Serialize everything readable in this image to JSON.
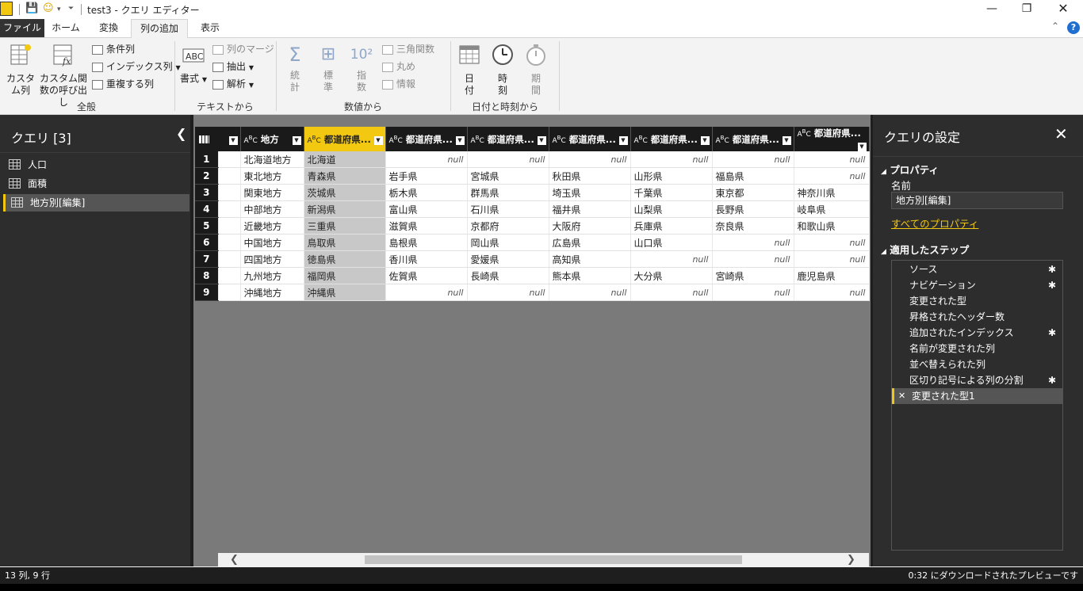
{
  "window": {
    "title": "test3 - クエリ エディター"
  },
  "tabs": [
    "ファイル",
    "ホーム",
    "変換",
    "列の追加",
    "表示"
  ],
  "ribbon": {
    "general": {
      "custom_column": "カスタム列",
      "custom_function": "カスタム関数の呼び出し",
      "conditional_column": "条件列",
      "index_column": "インデックス列",
      "duplicate_column": "重複する列",
      "label": "全般"
    },
    "text": {
      "format": "書式",
      "merge_columns": "列のマージ",
      "extract": "抽出",
      "parse": "解析",
      "label": "テキストから"
    },
    "number": {
      "statistics": "統計",
      "standard": "標準",
      "scientific": "指数",
      "trigonometry": "三角関数",
      "rounding": "丸め",
      "information": "情報",
      "label": "数値から"
    },
    "datetime": {
      "date": "日付",
      "time": "時刻",
      "duration": "期間",
      "label": "日付と時刻から"
    }
  },
  "queries": {
    "header": "クエリ [3]",
    "items": [
      "人口",
      "面積",
      "地方別[編集]"
    ]
  },
  "grid": {
    "columns": [
      "地方",
      "都道府県...",
      "都道府県...",
      "都道府県...",
      "都道府県...",
      "都道府県...",
      "都道府県...",
      "都道府県..."
    ],
    "rows": [
      [
        "1",
        "北海道地方",
        "北海道",
        "null",
        "null",
        "null",
        "null",
        "null",
        "null"
      ],
      [
        "2",
        "東北地方",
        "青森県",
        "岩手県",
        "宮城県",
        "秋田県",
        "山形県",
        "福島県",
        "null"
      ],
      [
        "3",
        "関東地方",
        "茨城県",
        "栃木県",
        "群馬県",
        "埼玉県",
        "千葉県",
        "東京都",
        "神奈川県"
      ],
      [
        "4",
        "中部地方",
        "新潟県",
        "富山県",
        "石川県",
        "福井県",
        "山梨県",
        "長野県",
        "岐阜県"
      ],
      [
        "5",
        "近畿地方",
        "三重県",
        "滋賀県",
        "京都府",
        "大阪府",
        "兵庫県",
        "奈良県",
        "和歌山県"
      ],
      [
        "6",
        "中国地方",
        "鳥取県",
        "島根県",
        "岡山県",
        "広島県",
        "山口県",
        "null",
        "null"
      ],
      [
        "7",
        "四国地方",
        "徳島県",
        "香川県",
        "愛媛県",
        "高知県",
        "null",
        "null",
        "null"
      ],
      [
        "8",
        "九州地方",
        "福岡県",
        "佐賀県",
        "長崎県",
        "熊本県",
        "大分県",
        "宮崎県",
        "鹿児島県"
      ],
      [
        "9",
        "沖縄地方",
        "沖縄県",
        "null",
        "null",
        "null",
        "null",
        "null",
        "null"
      ]
    ]
  },
  "settings": {
    "header": "クエリの設定",
    "properties_label": "プロパティ",
    "name_label": "名前",
    "name_value": "地方別[編集]",
    "all_properties": "すべてのプロパティ",
    "applied_steps_label": "適用したステップ",
    "steps": [
      {
        "label": "ソース",
        "gear": true
      },
      {
        "label": "ナビゲーション",
        "gear": true
      },
      {
        "label": "変更された型",
        "gear": false
      },
      {
        "label": "昇格されたヘッダー数",
        "gear": false
      },
      {
        "label": "追加されたインデックス",
        "gear": true
      },
      {
        "label": "名前が変更された列",
        "gear": false
      },
      {
        "label": "並べ替えられた列",
        "gear": false
      },
      {
        "label": "区切り記号による列の分割",
        "gear": true
      },
      {
        "label": "変更された型1",
        "gear": false
      }
    ]
  },
  "status": {
    "left": "13 列, 9 行",
    "right": "0:32 にダウンロードされたプレビューです"
  }
}
